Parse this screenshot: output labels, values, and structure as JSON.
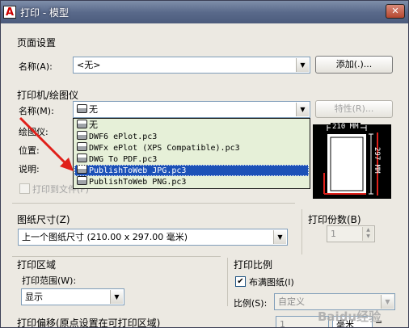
{
  "window": {
    "title": "打印 - 模型",
    "app_icon": "A",
    "close_symbol": "✕"
  },
  "page_setup": {
    "group_title": "页面设置",
    "name_label": "名称(A):",
    "name_value": "<无>",
    "add_button": "添加(.)..."
  },
  "printer": {
    "group_title": "打印机/绘图仪",
    "name_label": "名称(M):",
    "name_value": "无",
    "properties_button": "特性(R)...",
    "plotter_label": "绘图仪:",
    "location_label": "位置:",
    "description_label": "说明:",
    "print_to_file_label": "打印到文件(F)",
    "dropdown_items": [
      "无",
      "DWF6 ePlot.pc3",
      "DWFx ePlot (XPS Compatible).pc3",
      "DWG To PDF.pc3",
      "PublishToWeb JPG.pc3",
      "PublishToWeb PNG.pc3"
    ],
    "selected_index": 4,
    "preview_width_label": "210 MM",
    "preview_height_label": "297 MM"
  },
  "paper": {
    "group_title": "图纸尺寸(Z)",
    "value": "上一个图纸尺寸 (210.00 x 297.00 毫米)"
  },
  "copies": {
    "group_title": "打印份数(B)",
    "value": "1"
  },
  "area": {
    "group_title": "打印区域",
    "range_label": "打印范围(W):",
    "range_value": "显示"
  },
  "scale": {
    "group_title": "打印比例",
    "fit_label": "布满图纸(I)",
    "fit_checked": true,
    "ratio_label": "比例(S):",
    "ratio_value": "自定义"
  },
  "offset": {
    "group_title": "打印偏移(原点设置在可打印区域)",
    "value": "1",
    "unit": "毫米",
    "equals": "="
  },
  "watermark": "Baidu经验",
  "colors": {
    "accent": "#1c51b7",
    "arrow": "#e0201a",
    "dropdown_bg": "#e6f0d8"
  }
}
